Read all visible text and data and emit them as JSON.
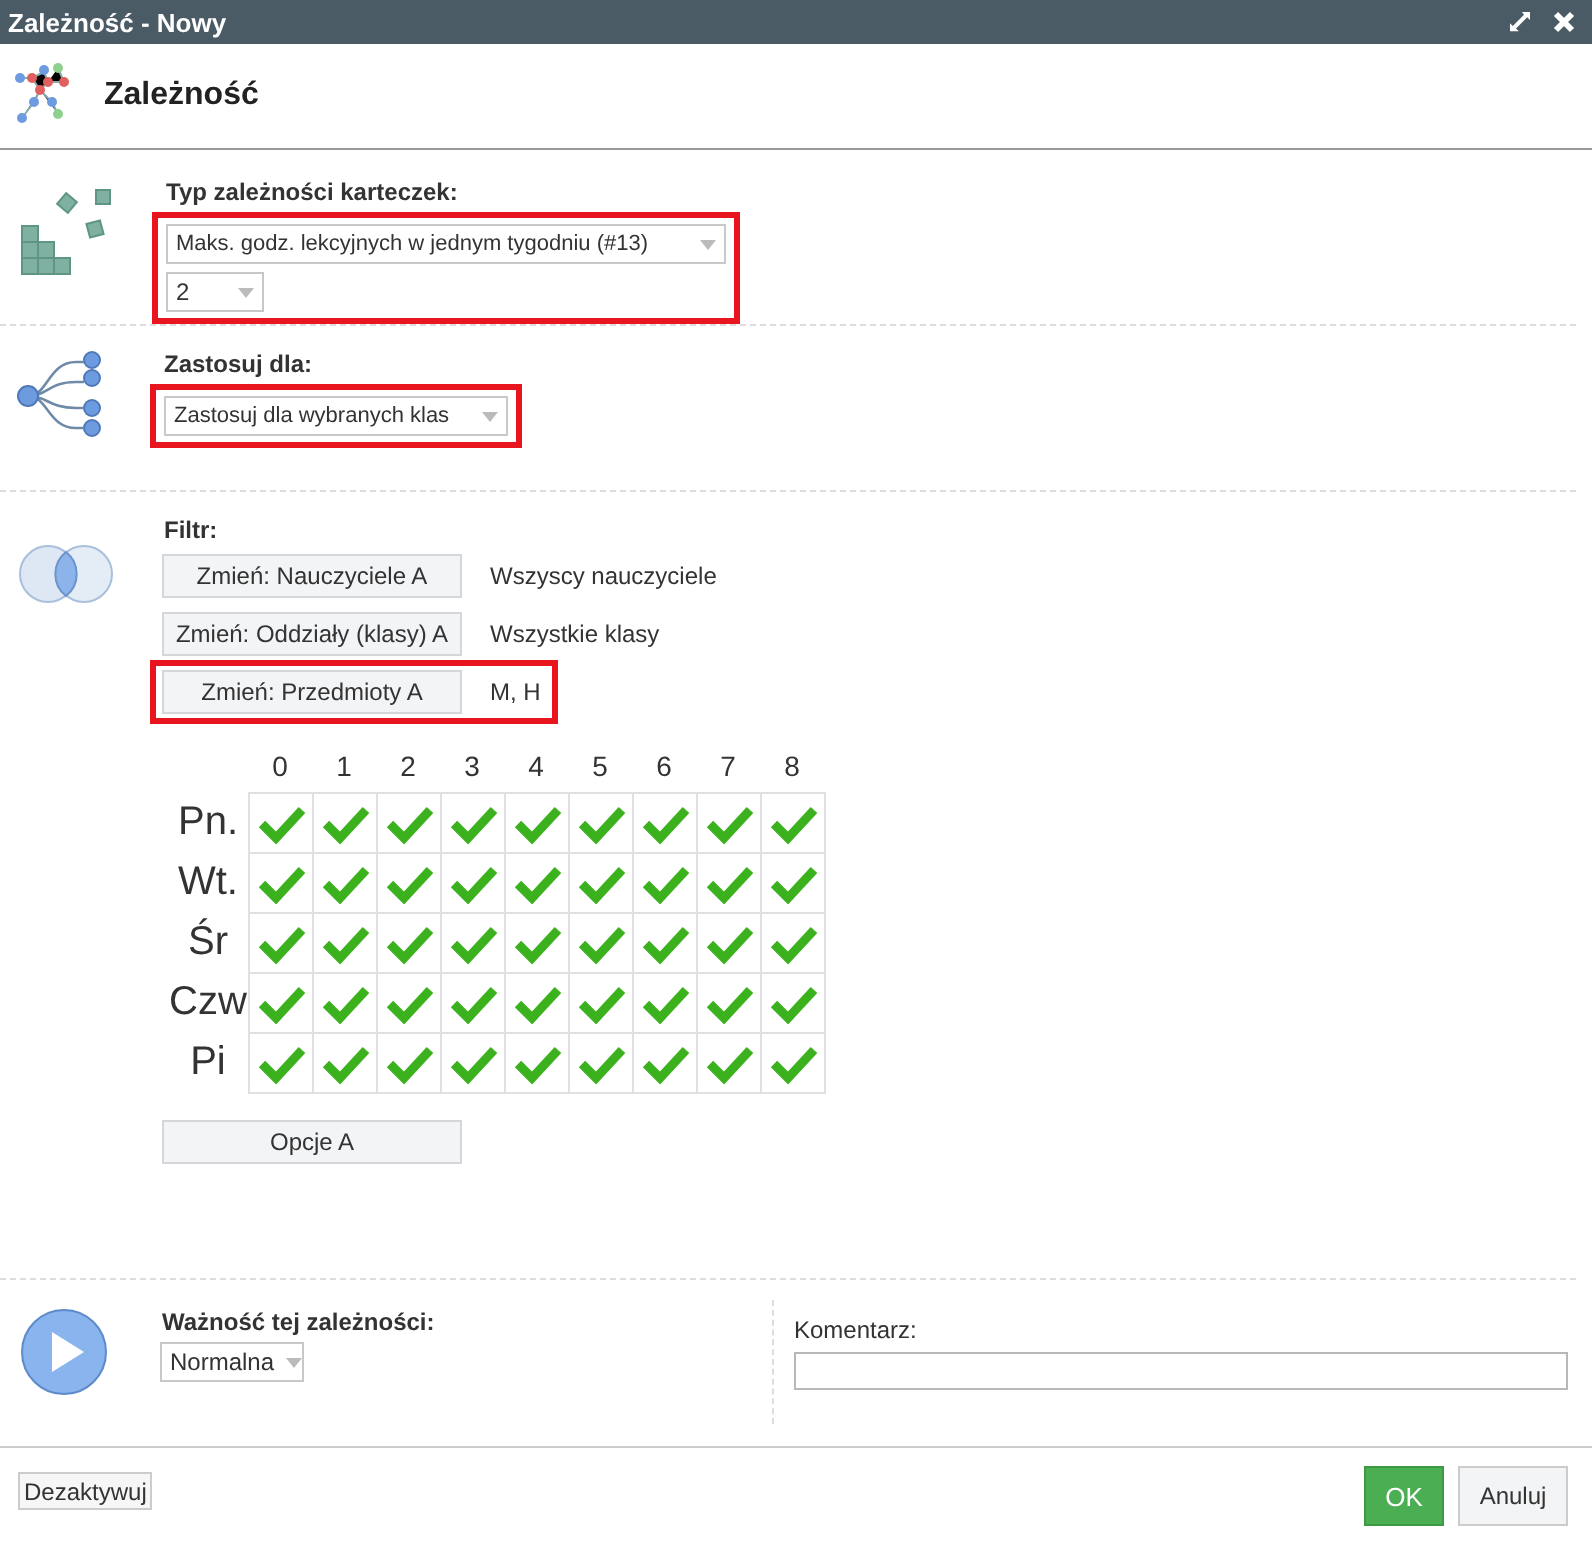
{
  "window": {
    "title": "Zależność - Nowy"
  },
  "header": {
    "title": "Zależność"
  },
  "type_section": {
    "label": "Typ zależności karteczek:",
    "highlighted": true,
    "type_select": {
      "value": "Maks. godz. lekcyjnych w jednym tygodniu (#13)"
    },
    "count_select": {
      "value": "2"
    }
  },
  "apply_section": {
    "label": "Zastosuj dla:",
    "highlighted": true,
    "apply_select": {
      "value": "Zastosuj dla wybranych klas"
    }
  },
  "filter_section": {
    "label": "Filtr:",
    "filters": [
      {
        "button": "Zmień: Nauczyciele A",
        "value": "Wszyscy nauczyciele",
        "highlighted": false
      },
      {
        "button": "Zmień: Oddziały (klasy) A",
        "value": "Wszystkie klasy",
        "highlighted": false
      },
      {
        "button": "Zmień: Przedmioty A",
        "value": "M, H",
        "highlighted": true
      }
    ],
    "grid": {
      "columns": [
        "0",
        "1",
        "2",
        "3",
        "4",
        "5",
        "6",
        "7",
        "8"
      ],
      "rows": [
        {
          "label": "Pn.",
          "checked": [
            true,
            true,
            true,
            true,
            true,
            true,
            true,
            true,
            true
          ]
        },
        {
          "label": "Wt.",
          "checked": [
            true,
            true,
            true,
            true,
            true,
            true,
            true,
            true,
            true
          ]
        },
        {
          "label": "Śr",
          "checked": [
            true,
            true,
            true,
            true,
            true,
            true,
            true,
            true,
            true
          ]
        },
        {
          "label": "Czw",
          "checked": [
            true,
            true,
            true,
            true,
            true,
            true,
            true,
            true,
            true
          ]
        },
        {
          "label": "Pi",
          "checked": [
            true,
            true,
            true,
            true,
            true,
            true,
            true,
            true,
            true
          ]
        }
      ]
    },
    "options_button": "Opcje A"
  },
  "importance": {
    "label": "Ważność tej zależności:",
    "select": {
      "value": "Normalna"
    }
  },
  "comment": {
    "label": "Komentarz:"
  },
  "footer": {
    "deactivate": "Dezaktywuj",
    "ok": "OK",
    "cancel": "Anuluj"
  }
}
